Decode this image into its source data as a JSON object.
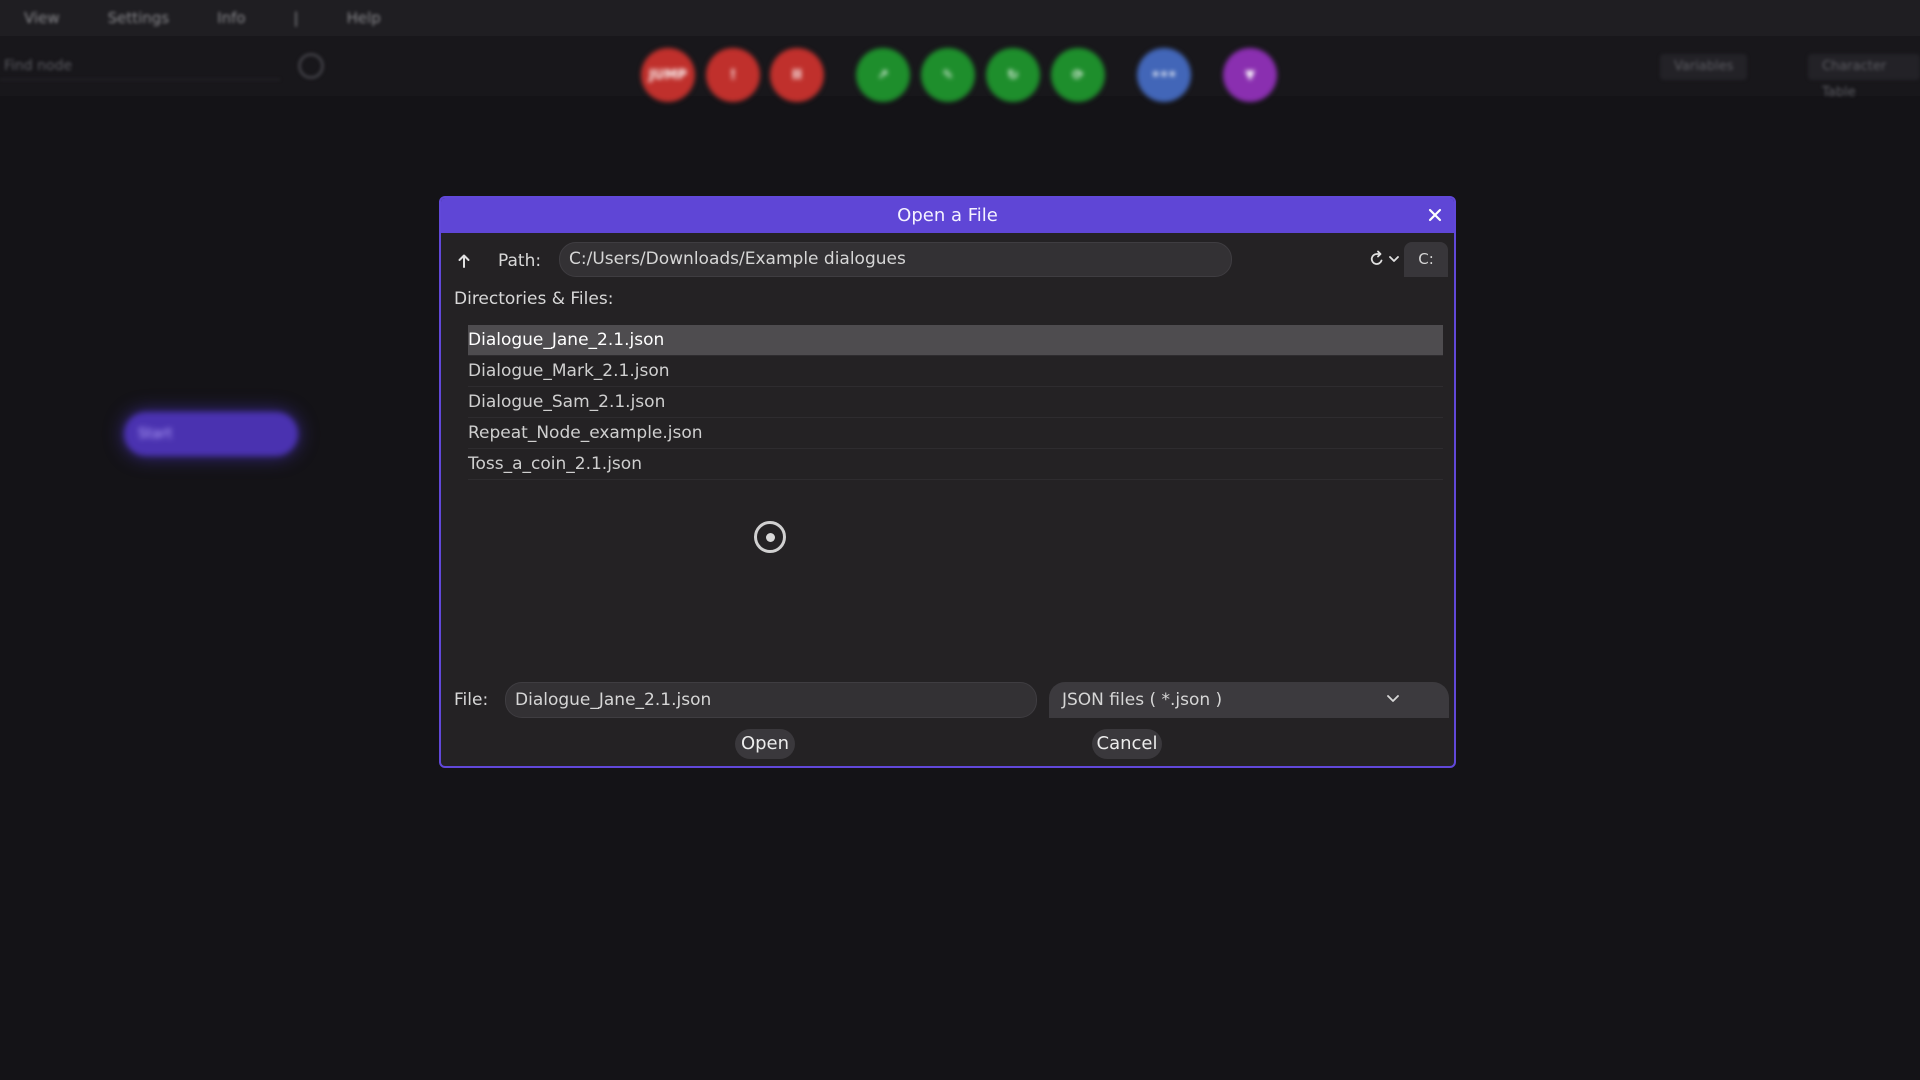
{
  "background": {
    "menu": [
      "View",
      "Settings",
      "Info",
      "|",
      "Help"
    ],
    "search_placeholder": "Find node",
    "toolbar_buttons": [
      {
        "label": "JUMP",
        "color": "#c0302c"
      },
      {
        "label": "!",
        "color": "#c0302c"
      },
      {
        "label": "II",
        "color": "#c0302c"
      },
      {
        "label": "↗",
        "color": "#1e8e2c"
      },
      {
        "label": "✎",
        "color": "#1e8e2c"
      },
      {
        "label": "↻",
        "color": "#1e8e2c"
      },
      {
        "label": "⟳",
        "color": "#1e8e2c"
      },
      {
        "label": "•••",
        "color": "#4266b8"
      },
      {
        "label": "▼",
        "color": "#8a2fb0"
      }
    ],
    "right_buttons": [
      "Variables",
      "Character Table"
    ],
    "node_label": "Start"
  },
  "dialog": {
    "title": "Open a File",
    "path_label": "Path:",
    "path_value": "C:/Users/Downloads/Example dialogues",
    "drive": "C:",
    "list_label": "Directories & Files:",
    "files": [
      "Dialogue_Jane_2.1.json",
      "Dialogue_Mark_2.1.json",
      "Dialogue_Sam_2.1.json",
      "Repeat_Node_example.json",
      "Toss_a_coin_2.1.json"
    ],
    "selected_index": 0,
    "file_label": "File:",
    "file_value": "Dialogue_Jane_2.1.json",
    "filter_value": "JSON files ( *.json )",
    "open_label": "Open",
    "cancel_label": "Cancel"
  },
  "colors": {
    "accent": "#5f46d6",
    "dialog_bg": "#242224",
    "selection": "#4e4c4f"
  },
  "icons": [
    "up-arrow-icon",
    "close-icon",
    "refresh-icon",
    "chevron-down-icon",
    "target-cursor-icon"
  ]
}
